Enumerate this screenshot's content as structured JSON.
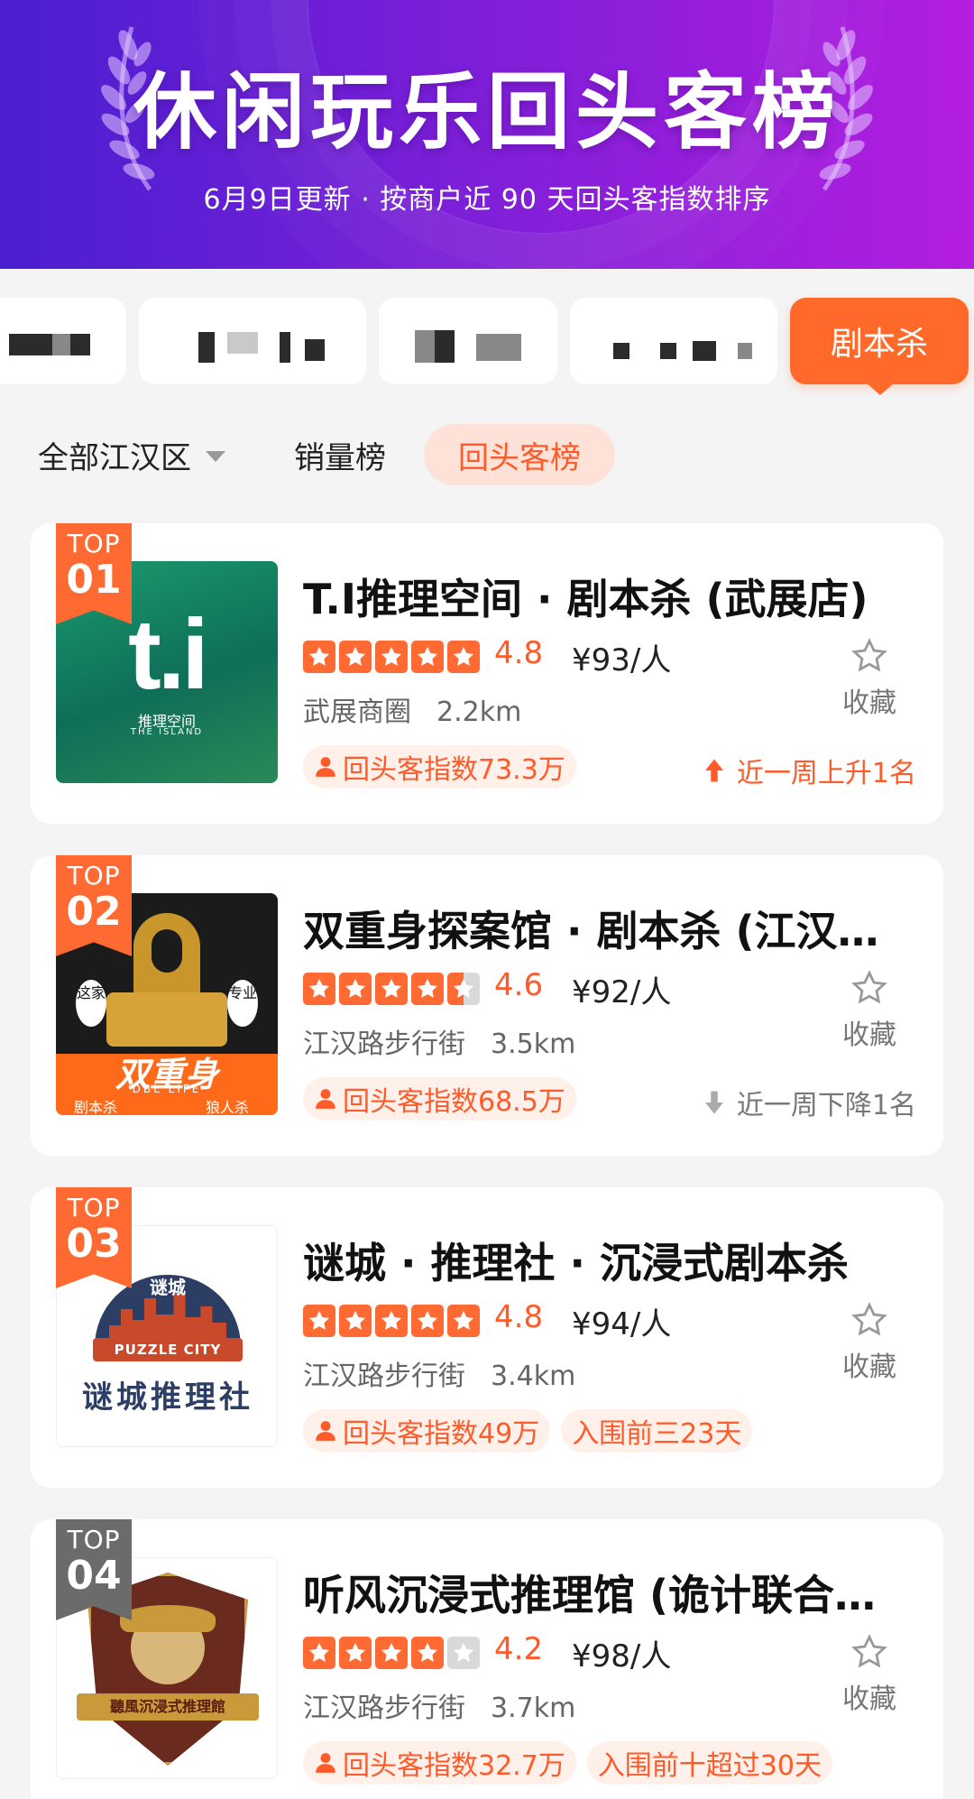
{
  "header": {
    "title": "休闲玩乐回头客榜",
    "subtitle": "6月9日更新 · 按商户近 90 天回头客指数排序"
  },
  "categories": {
    "active_label": "剧本杀",
    "others": [
      "(blurred)",
      "(blurred)",
      "(blurred)",
      "(blurred)"
    ]
  },
  "filters": {
    "area": "全部江汉区",
    "sales": "销量榜",
    "repeat": "回头客榜"
  },
  "icons": [
    "laurel-icon",
    "chevron-down-icon",
    "star-icon",
    "star-outline-icon",
    "person-icon",
    "arrow-up-icon",
    "arrow-down-icon"
  ],
  "colors": {
    "accent": "#ff6a33",
    "header_start": "#4a1fd0",
    "header_end": "#b41ee0",
    "badge_gray": "#6b6b6b"
  },
  "items": [
    {
      "badge_top": "TOP",
      "badge_rank": "01",
      "name": "T.I推理空间 · 剧本杀 (武展店)",
      "rating": 4.8,
      "score": "4.8",
      "price": "¥93/人",
      "area": "武展商圈",
      "distance": "2.2km",
      "fav": "收藏",
      "tag1": "回头客指数73.3万",
      "trend": "近一周上升1名",
      "thumb_text": "t.i",
      "thumb_sub": "推理空间",
      "thumb_sub2": "THE ISLAND"
    },
    {
      "badge_top": "TOP",
      "badge_rank": "02",
      "name": "双重身探案馆 · 剧本杀 (江汉…",
      "rating": 4.6,
      "score": "4.6",
      "price": "¥92/人",
      "area": "江汉路步行街",
      "distance": "3.5km",
      "fav": "收藏",
      "tag1": "回头客指数68.5万",
      "trend": "近一周下降1名",
      "thumb_text": "双重身",
      "thumb_sub": "DBL LIFE",
      "thumb_left": "剧本杀",
      "thumb_right": "狼人杀",
      "thumb_tag1": "这家",
      "thumb_tag2": "专业"
    },
    {
      "badge_top": "TOP",
      "badge_rank": "03",
      "name": "谜城 · 推理社 · 沉浸式剧本杀",
      "rating": 4.8,
      "score": "4.8",
      "price": "¥94/人",
      "area": "江汉路步行街",
      "distance": "3.4km",
      "fav": "收藏",
      "tag1": "回头客指数49万",
      "tag2": "入围前三23天",
      "thumb_top": "谜城",
      "thumb_mid": "PUZZLE CITY",
      "thumb_text": "谜城推理社"
    },
    {
      "badge_top": "TOP",
      "badge_rank": "04",
      "name": "听风沉浸式推理馆 (诡计联合…",
      "rating": 4.2,
      "score": "4.2",
      "price": "¥98/人",
      "area": "江汉路步行街",
      "distance": "3.7km",
      "fav": "收藏",
      "tag1": "回头客指数32.7万",
      "tag2": "入围前十超过30天",
      "thumb_text": "聽風沉浸式推理館"
    }
  ]
}
